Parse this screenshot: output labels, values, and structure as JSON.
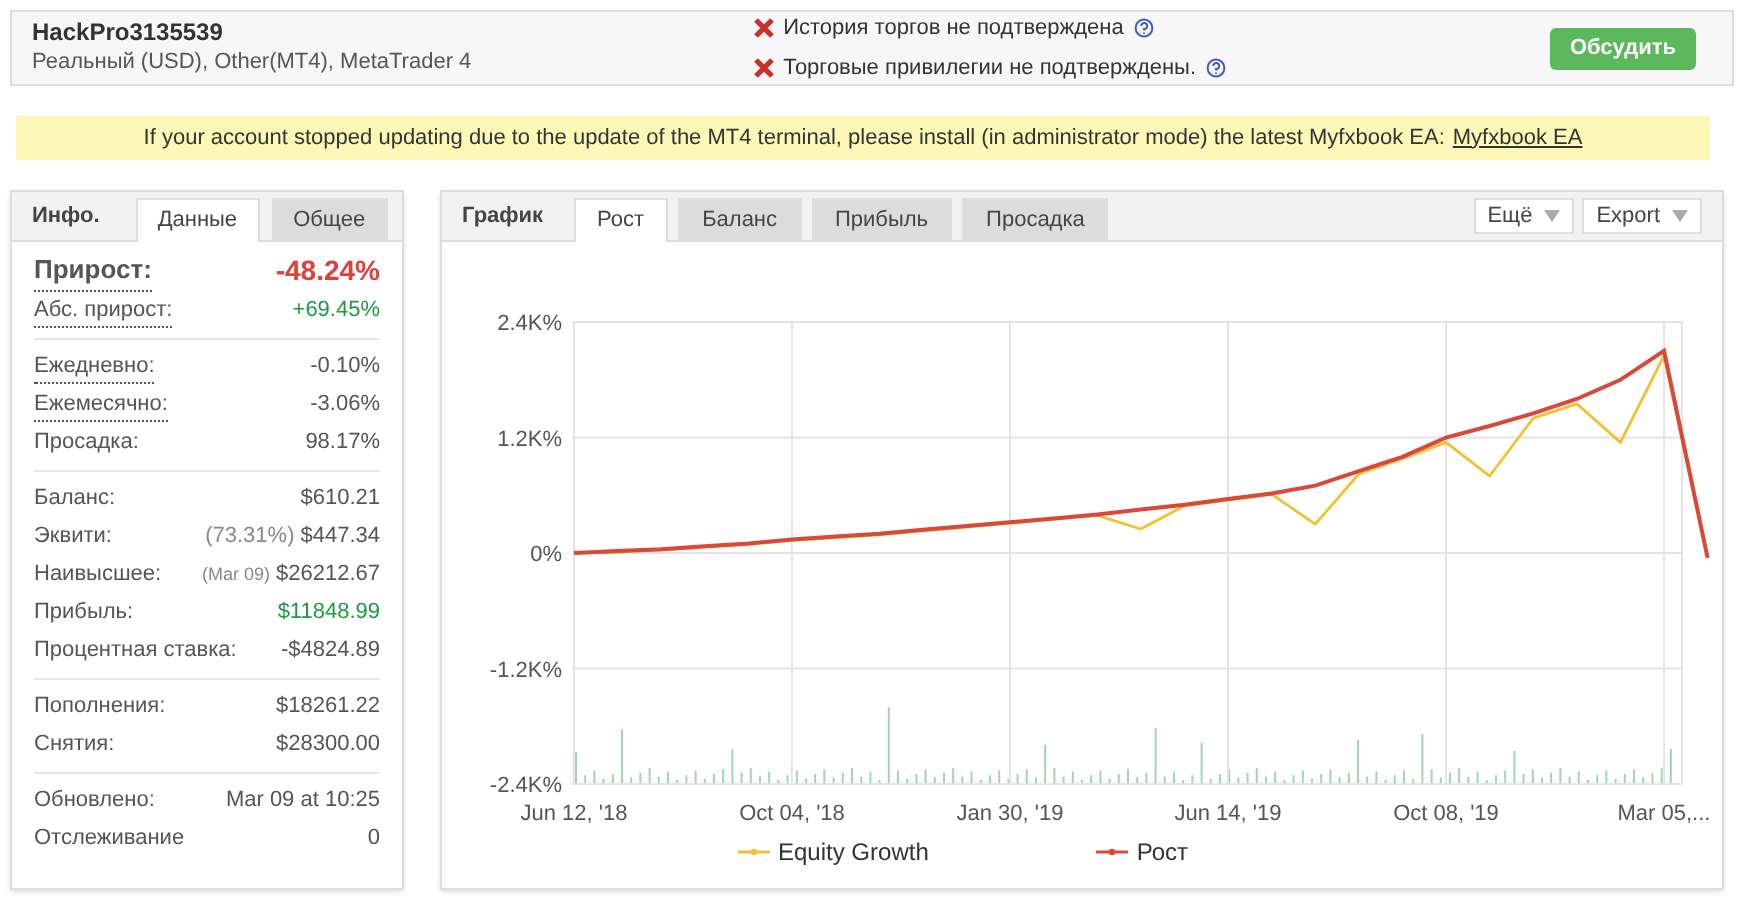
{
  "account": {
    "name": "HackPro3135539",
    "details": "Реальный (USD), Other(MT4), MetaTrader 4"
  },
  "verification": [
    {
      "text": "История торгов не подтверждена",
      "verified": false
    },
    {
      "text": "Торговые привилегии не подтверждены.",
      "verified": false
    }
  ],
  "discuss_button": "Обсудить",
  "notice": {
    "text": "If your account stopped updating due to the update of the MT4 terminal, please install (in administrator mode) the latest Myfxbook EA:",
    "link": "Myfxbook EA"
  },
  "info_panel": {
    "title": "Инфо.",
    "tabs": [
      {
        "label": "Данные",
        "selected": true
      },
      {
        "label": "Общее",
        "selected": false
      }
    ],
    "groups": [
      [
        {
          "label": "Прирост:",
          "value": "-48.24%",
          "color": "#e0403a",
          "headline": true,
          "dotted": true
        },
        {
          "label": "Абс. прирост:",
          "value": "+69.45%",
          "color": "#1e9b3e",
          "headline": false,
          "dotted": true
        }
      ],
      [
        {
          "label": "Ежедневно:",
          "value": "-0.10%",
          "headline": false,
          "dotted": true
        },
        {
          "label": "Ежемесячно:",
          "value": "-3.06%",
          "headline": false,
          "dotted": true
        },
        {
          "label": "Просадка:",
          "value": "98.17%",
          "headline": false,
          "dotted": false
        }
      ],
      [
        {
          "label": "Баланс:",
          "value": "$610.21",
          "headline": false,
          "dotted": false
        },
        {
          "label": "Эквити:",
          "note": "(73.31%)",
          "value": "$447.34",
          "headline": false,
          "dotted": false
        },
        {
          "label": "Наивысшее:",
          "note": "(Mar 09)",
          "value": "$26212.67",
          "headline": false,
          "dotted": false
        },
        {
          "label": "Прибыль:",
          "value": "$11848.99",
          "color": "#1e9b3e",
          "headline": false,
          "dotted": false
        },
        {
          "label": "Процентная ставка:",
          "value": "-$4824.89",
          "headline": false,
          "dotted": false
        }
      ],
      [
        {
          "label": "Пополнения:",
          "value": "$18261.22",
          "headline": false,
          "dotted": false
        },
        {
          "label": "Снятия:",
          "value": "$28300.00",
          "headline": false,
          "dotted": false
        }
      ],
      [
        {
          "label": "Обновлено:",
          "value": "Mar 09 at 10:25",
          "headline": false,
          "dotted": false
        },
        {
          "label": "Отслеживание",
          "value": "0",
          "headline": false,
          "dotted": false
        }
      ]
    ]
  },
  "chart_panel": {
    "title": "График",
    "tabs": [
      {
        "label": "Рост",
        "selected": true
      },
      {
        "label": "Баланс",
        "selected": false
      },
      {
        "label": "Прибыль",
        "selected": false
      },
      {
        "label": "Просадка",
        "selected": false
      }
    ],
    "menus": [
      "Ещё",
      "Export"
    ],
    "chart_data": {
      "type": "line",
      "grid": true,
      "legend": true,
      "categories": [
        "Jun 12, '18",
        null,
        null,
        null,
        null,
        "Oct 04, '18",
        null,
        null,
        null,
        null,
        "Jan 30, '19",
        null,
        null,
        null,
        null,
        "Jun 14, '19",
        null,
        null,
        null,
        null,
        "Oct 08, '19",
        null,
        null,
        null,
        null,
        "Mar 05,...",
        null
      ],
      "ylim": [
        -2400,
        2400
      ],
      "yticks": [
        {
          "value": 2400,
          "label": "2.4K%"
        },
        {
          "value": 1200,
          "label": "1.2K%"
        },
        {
          "value": 0,
          "label": "0%"
        },
        {
          "value": -1200,
          "label": "-1.2K%"
        },
        {
          "value": -2400,
          "label": "-2.4K%"
        }
      ],
      "series": [
        {
          "name": "Equity Growth",
          "color": "#f2c12e",
          "values": [
            0,
            10,
            30,
            60,
            90,
            130,
            160,
            190,
            230,
            270,
            310,
            350,
            390,
            250,
            490,
            550,
            610,
            300,
            820,
            980,
            1150,
            800,
            1400,
            1550,
            1150,
            2050,
            -50
          ]
        },
        {
          "name": "Рост",
          "color": "#d9483b",
          "values": [
            0,
            20,
            40,
            70,
            100,
            140,
            170,
            200,
            240,
            280,
            320,
            360,
            400,
            450,
            500,
            560,
            620,
            700,
            850,
            1000,
            1200,
            1320,
            1450,
            1600,
            1800,
            2100,
            -50
          ]
        }
      ]
    }
  }
}
